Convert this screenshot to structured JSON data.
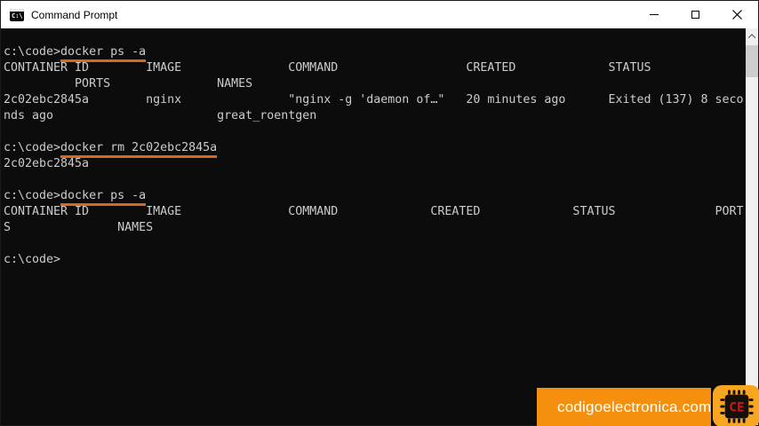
{
  "window": {
    "title": "Command Prompt"
  },
  "terminal": {
    "lines": [
      {
        "segments": [
          {
            "text": "c:\\code>",
            "underline": false
          },
          {
            "text": "docker ps -a",
            "underline": true
          }
        ]
      },
      {
        "segments": [
          {
            "text": "CONTAINER ID        IMAGE               COMMAND                  CREATED             STATUS",
            "underline": false
          }
        ]
      },
      {
        "segments": [
          {
            "text": "          PORTS               NAMES",
            "underline": false
          }
        ]
      },
      {
        "segments": [
          {
            "text": "2c02ebc2845a        nginx               \"nginx -g 'daemon of…\"   20 minutes ago      Exited (137) 8 seco",
            "underline": false
          }
        ]
      },
      {
        "segments": [
          {
            "text": "nds ago                       great_roentgen",
            "underline": false
          }
        ]
      },
      {
        "segments": []
      },
      {
        "segments": [
          {
            "text": "c:\\code>",
            "underline": false
          },
          {
            "text": "docker rm 2c02ebc2845a",
            "underline": true
          }
        ]
      },
      {
        "segments": [
          {
            "text": "2c02ebc2845a",
            "underline": false
          }
        ]
      },
      {
        "segments": []
      },
      {
        "segments": [
          {
            "text": "c:\\code>",
            "underline": false
          },
          {
            "text": "docker ps -a",
            "underline": true
          }
        ]
      },
      {
        "segments": [
          {
            "text": "CONTAINER ID        IMAGE               COMMAND             CREATED             STATUS              PORT",
            "underline": false
          }
        ]
      },
      {
        "segments": [
          {
            "text": "S               NAMES",
            "underline": false
          }
        ]
      },
      {
        "segments": []
      },
      {
        "segments": [
          {
            "text": "c:\\code>",
            "underline": false
          }
        ]
      }
    ]
  },
  "watermark": {
    "text": "codigoelectronica.com",
    "chip_text": "CE"
  },
  "icons": {
    "app_icon_glyph": "C:\\",
    "titlebar_buttons": [
      "minimize",
      "maximize",
      "close"
    ]
  },
  "colors": {
    "titlebar_bg": "#ffffff",
    "title_text": "#000000",
    "terminal_bg": "#0c0c0c",
    "terminal_text": "#cccccc",
    "underline": "#d8681c",
    "scrollbar_track": "#f0f0f0",
    "scrollbar_thumb": "#cdcdcd",
    "watermark_bar": "#f5900f",
    "watermark_badge": "#f8a61f",
    "chip_red": "#d21616"
  }
}
